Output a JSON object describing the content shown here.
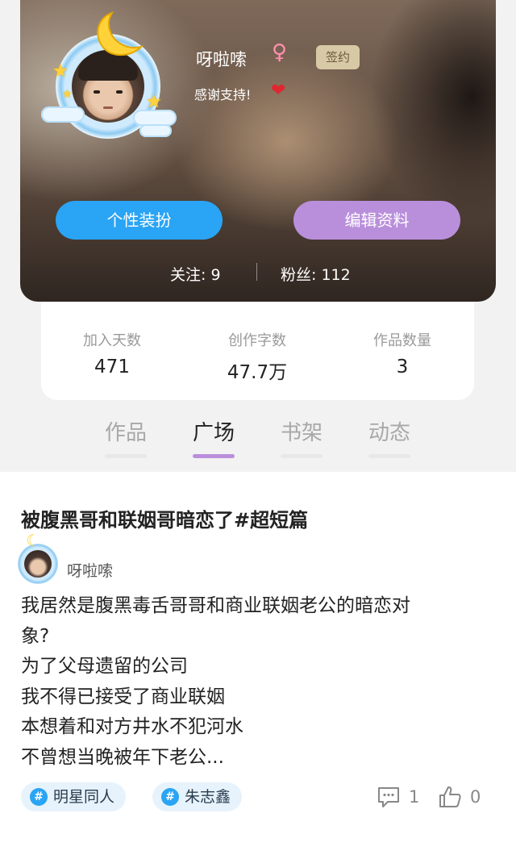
{
  "profile": {
    "name": "呀啦嗦",
    "gender_icon": "female-symbol-icon",
    "gender_symbol": "♀",
    "badge": "签约",
    "bio": "感谢支持!",
    "bio_icon": "heart-icon",
    "heart_symbol": "❤",
    "avatar_decor": [
      "moon-icon",
      "star-icon",
      "cloud-icon"
    ]
  },
  "buttons": {
    "dress_up": "个性装扮",
    "edit_profile": "编辑资料"
  },
  "follow": {
    "following": "关注: 9",
    "fans": "粉丝: 112"
  },
  "stats": [
    {
      "label": "加入天数",
      "value": "471"
    },
    {
      "label": "创作字数",
      "value": "47.7万"
    },
    {
      "label": "作品数量",
      "value": "3"
    }
  ],
  "tabs": [
    {
      "label": "作品",
      "active": false
    },
    {
      "label": "广场",
      "active": true
    },
    {
      "label": "书架",
      "active": false
    },
    {
      "label": "动态",
      "active": false
    }
  ],
  "post": {
    "title": "被腹黑哥和联姻哥暗恋了#超短篇",
    "author": "呀啦嗦",
    "body": [
      "我居然是腹黑毒舌哥哥和商业联姻老公的暗恋对",
      "象?",
      "为了父母遗留的公司",
      "我不得已接受了商业联姻",
      "本想着和对方井水不犯河水",
      "不曾想当晚被年下老公..."
    ],
    "tags": [
      {
        "hash": "#",
        "label": "明星同人"
      },
      {
        "hash": "#",
        "label": "朱志鑫"
      }
    ],
    "comments": "1",
    "likes": "0"
  },
  "colors": {
    "accent_blue": "#2aa4f4",
    "accent_purple": "#b98fdc",
    "heart_red": "#e0262f",
    "tag_bg": "#e6f3fd"
  }
}
